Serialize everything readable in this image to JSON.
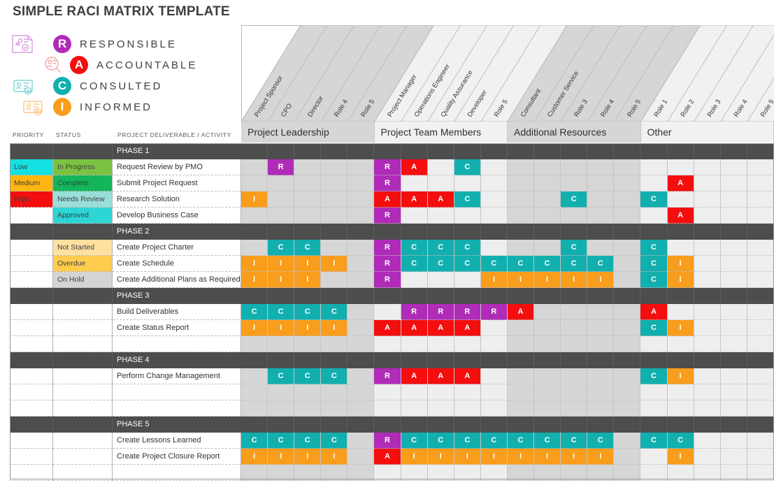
{
  "title": "SIMPLE RACI MATRIX TEMPLATE",
  "legend": [
    {
      "key": "R",
      "label": "RESPONSIBLE",
      "color": "#b02bb8",
      "icon": "document-person-icon"
    },
    {
      "key": "A",
      "label": "ACCOUNTABLE",
      "color": "#f40e0e",
      "icon": "person-search-icon"
    },
    {
      "key": "C",
      "label": "CONSULTED",
      "color": "#12afaf",
      "icon": "id-card-download-icon"
    },
    {
      "key": "I",
      "label": "INFORMED",
      "color": "#f99d1c",
      "icon": "id-card-upload-icon"
    }
  ],
  "left_headers": {
    "priority": "PRIORITY",
    "status": "STATUS",
    "activity": "PROJECT DELIVERABLE / ACTIVITY"
  },
  "groups": [
    {
      "name": "Project Leadership",
      "shade": "dark",
      "span": 5
    },
    {
      "name": "Project Team Members",
      "shade": "light",
      "span": 5
    },
    {
      "name": "Additional Resources",
      "shade": "dark",
      "span": 5
    },
    {
      "name": "Other",
      "shade": "light",
      "span": 5
    }
  ],
  "roles": [
    "Project Sponsor",
    "CPO",
    "Director",
    "Role 4",
    "Role 5",
    "Project Manager",
    "Operations Engineer",
    "Quality Assurance",
    "Developer",
    "Role 5",
    "Consultant",
    "Customer Service",
    "Role 3",
    "Role 4",
    "Role 5",
    "Role 1",
    "Role 2",
    "Role 3",
    "Role 4",
    "Role 5"
  ],
  "priority_colors": {
    "Low": "#13e0e0",
    "Medium": "#ffb612",
    "High": "#f40e0e"
  },
  "status_colors": {
    "In Progress": "#7cc242",
    "Complete": "#14b55b",
    "Needs Review": "#9aded9",
    "Approved": "#2ed5d5",
    "Not Started": "#ffe0a0",
    "Overdue": "#ffcc4d",
    "On Hold": "#d4d4d4"
  },
  "rows": [
    {
      "type": "phase",
      "activity": "PHASE 1",
      "priority": "",
      "status": "",
      "cells": []
    },
    {
      "type": "task",
      "activity": "Request Review by PMO",
      "priority": "Low",
      "status": "In Progress",
      "cells": [
        "",
        "R",
        "",
        "",
        "",
        "R",
        "A",
        "",
        "C",
        "",
        "",
        "",
        "",
        "",
        "",
        "",
        "",
        "",
        "",
        ""
      ]
    },
    {
      "type": "task",
      "activity": "Submit Project Request",
      "priority": "Medium",
      "status": "Complete",
      "cells": [
        "",
        "",
        "",
        "",
        "",
        "R",
        "",
        "",
        "",
        "",
        "",
        "",
        "",
        "",
        "",
        "",
        "A",
        "",
        "",
        ""
      ]
    },
    {
      "type": "task",
      "activity": "Research Solution",
      "priority": "High",
      "status": "Needs Review",
      "cells": [
        "I",
        "",
        "",
        "",
        "",
        "A",
        "A",
        "A",
        "C",
        "",
        "",
        "",
        "C",
        "",
        "",
        "C",
        "",
        "",
        "",
        ""
      ]
    },
    {
      "type": "task",
      "activity": "Develop Business Case",
      "priority": "",
      "status": "Approved",
      "cells": [
        "",
        "",
        "",
        "",
        "",
        "R",
        "",
        "",
        "",
        "",
        "",
        "",
        "",
        "",
        "",
        "",
        "A",
        "",
        "",
        ""
      ]
    },
    {
      "type": "phase",
      "activity": "PHASE 2",
      "priority": "",
      "status": "",
      "cells": []
    },
    {
      "type": "task",
      "activity": "Create Project Charter",
      "priority": "",
      "status": "Not Started",
      "cells": [
        "",
        "C",
        "C",
        "",
        "",
        "R",
        "C",
        "C",
        "C",
        "",
        "",
        "",
        "C",
        "",
        "",
        "C",
        "",
        "",
        "",
        ""
      ]
    },
    {
      "type": "task",
      "activity": "Create Schedule",
      "priority": "",
      "status": "Overdue",
      "cells": [
        "I",
        "I",
        "I",
        "I",
        "",
        "R",
        "C",
        "C",
        "C",
        "C",
        "C",
        "C",
        "C",
        "C",
        "",
        "C",
        "I",
        "",
        "",
        ""
      ]
    },
    {
      "type": "task",
      "activity": "Create Additional Plans as Required",
      "priority": "",
      "status": "On Hold",
      "cells": [
        "I",
        "I",
        "I",
        "",
        "",
        "R",
        "",
        "",
        "",
        "I",
        "I",
        "I",
        "I",
        "I",
        "",
        "C",
        "I",
        "",
        "",
        ""
      ]
    },
    {
      "type": "phase",
      "activity": "PHASE 3",
      "priority": "",
      "status": "",
      "cells": []
    },
    {
      "type": "task",
      "activity": "Build Deliverables",
      "priority": "",
      "status": "",
      "cells": [
        "C",
        "C",
        "C",
        "C",
        "",
        "",
        "R",
        "R",
        "R",
        "R",
        "A",
        "",
        "",
        "",
        "",
        "A",
        "",
        "",
        "",
        ""
      ]
    },
    {
      "type": "task",
      "activity": "Create Status Report",
      "priority": "",
      "status": "",
      "cells": [
        "I",
        "I",
        "I",
        "I",
        "",
        "A",
        "A",
        "A",
        "A",
        "",
        "",
        "",
        "",
        "",
        "",
        "C",
        "I",
        "",
        "",
        ""
      ]
    },
    {
      "type": "task",
      "activity": "",
      "priority": "",
      "status": "",
      "cells": []
    },
    {
      "type": "phase",
      "activity": "PHASE 4",
      "priority": "",
      "status": "",
      "cells": []
    },
    {
      "type": "task",
      "activity": "Perform Change Management",
      "priority": "",
      "status": "",
      "cells": [
        "",
        "C",
        "C",
        "C",
        "",
        "R",
        "A",
        "A",
        "A",
        "",
        "",
        "",
        "",
        "",
        "",
        "C",
        "I",
        "",
        "",
        ""
      ]
    },
    {
      "type": "task",
      "activity": "",
      "priority": "",
      "status": "",
      "cells": []
    },
    {
      "type": "task",
      "activity": "",
      "priority": "",
      "status": "",
      "cells": []
    },
    {
      "type": "phase",
      "activity": "PHASE 5",
      "priority": "",
      "status": "",
      "cells": []
    },
    {
      "type": "task",
      "activity": "Create Lessons Learned",
      "priority": "",
      "status": "",
      "cells": [
        "C",
        "C",
        "C",
        "C",
        "",
        "R",
        "C",
        "C",
        "C",
        "C",
        "C",
        "C",
        "C",
        "C",
        "",
        "C",
        "C",
        "",
        "",
        ""
      ]
    },
    {
      "type": "task",
      "activity": "Create Project Closure Report",
      "priority": "",
      "status": "",
      "cells": [
        "I",
        "I",
        "I",
        "I",
        "",
        "A",
        "I",
        "I",
        "I",
        "I",
        "I",
        "I",
        "I",
        "I",
        "",
        "",
        "I",
        "",
        "",
        ""
      ]
    },
    {
      "type": "task",
      "activity": "",
      "priority": "",
      "status": "",
      "cells": []
    }
  ]
}
